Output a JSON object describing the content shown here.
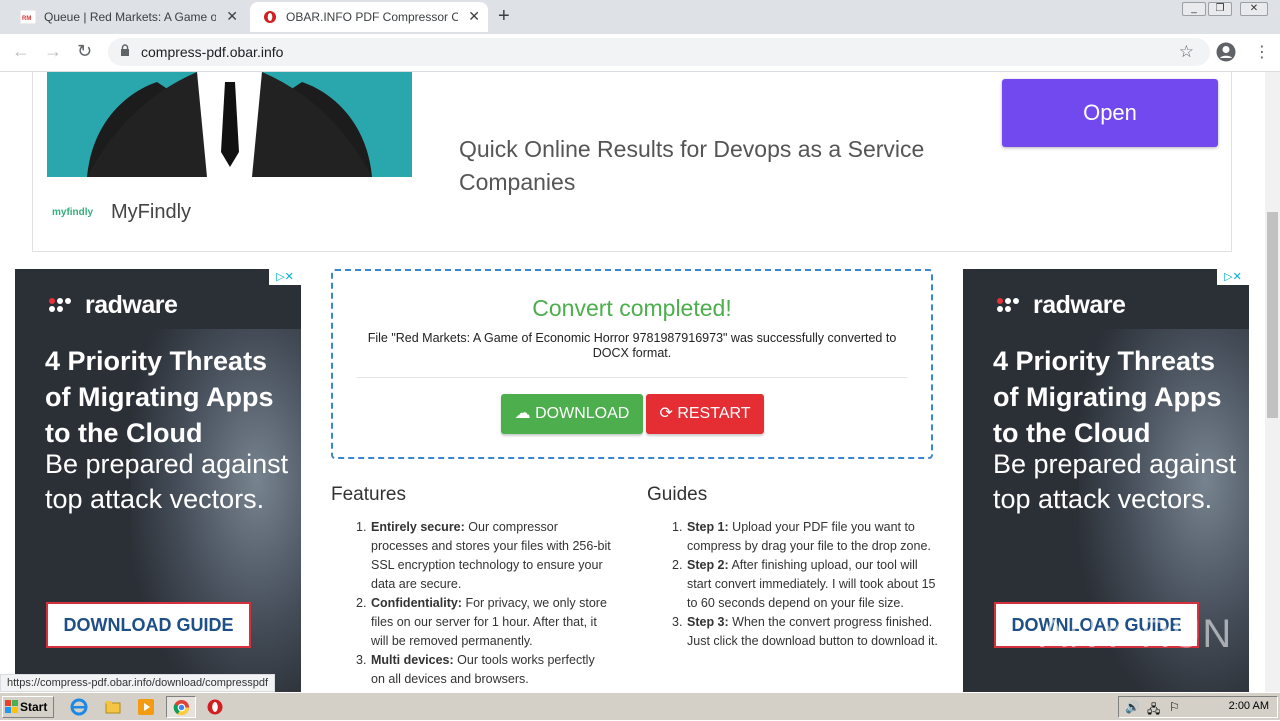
{
  "browser": {
    "tabs": [
      {
        "title": "Queue | Red Markets: A Game of Ec",
        "active": false
      },
      {
        "title": "OBAR.INFO PDF Compressor Online",
        "active": true
      }
    ],
    "url": "compress-pdf.obar.info",
    "status_url": "https://compress-pdf.obar.info/download/compresspdf"
  },
  "top_ad": {
    "headline": "Quick Online Results for Devops as a Service Companies",
    "button": "Open",
    "brand_logo": "myfindly",
    "brand_name": "MyFindly"
  },
  "side_ad": {
    "logo": "radware",
    "headline": "4 Priority Threats of Migrating Apps to the Cloud",
    "subline": "Be prepared against top attack vectors.",
    "button": "DOWNLOAD GUIDE"
  },
  "convert": {
    "title": "Convert completed!",
    "message": "File \"Red Markets: A Game of Economic Horror 9781987916973\" was successfully converted to DOCX format.",
    "download_label": "DOWNLOAD",
    "restart_label": "RESTART"
  },
  "features": {
    "title": "Features",
    "items": [
      {
        "n": "1.",
        "bold": "Entirely secure:",
        "text": " Our compressor processes and stores your files with 256-bit SSL encryption technology to ensure your data are secure."
      },
      {
        "n": "2.",
        "bold": "Confidentiality:",
        "text": " For privacy, we only store files on our server for 1 hour. After that, it will be removed permanently."
      },
      {
        "n": "3.",
        "bold": "Multi devices:",
        "text": " Our tools works perfectly on all devices and browsers."
      }
    ]
  },
  "guides": {
    "title": "Guides",
    "items": [
      {
        "n": "1.",
        "bold": "Step 1:",
        "text": " Upload your PDF file you want to compress by drag your file to the drop zone."
      },
      {
        "n": "2.",
        "bold": "Step 2:",
        "text": " After finishing upload, our tool will start convert immediately. I will took about 15 to 60 seconds depend on your file size."
      },
      {
        "n": "3.",
        "bold": "Step 3:",
        "text": " When the convert progress finished. Just click the download button to download it."
      }
    ]
  },
  "watermark": "ANY RUN",
  "taskbar": {
    "start": "Start",
    "clock": "2:00 AM"
  },
  "colors": {
    "success": "#4cae4c",
    "danger": "#e52d34",
    "accent": "#7249ef",
    "dashed_border": "#3a87d0"
  }
}
